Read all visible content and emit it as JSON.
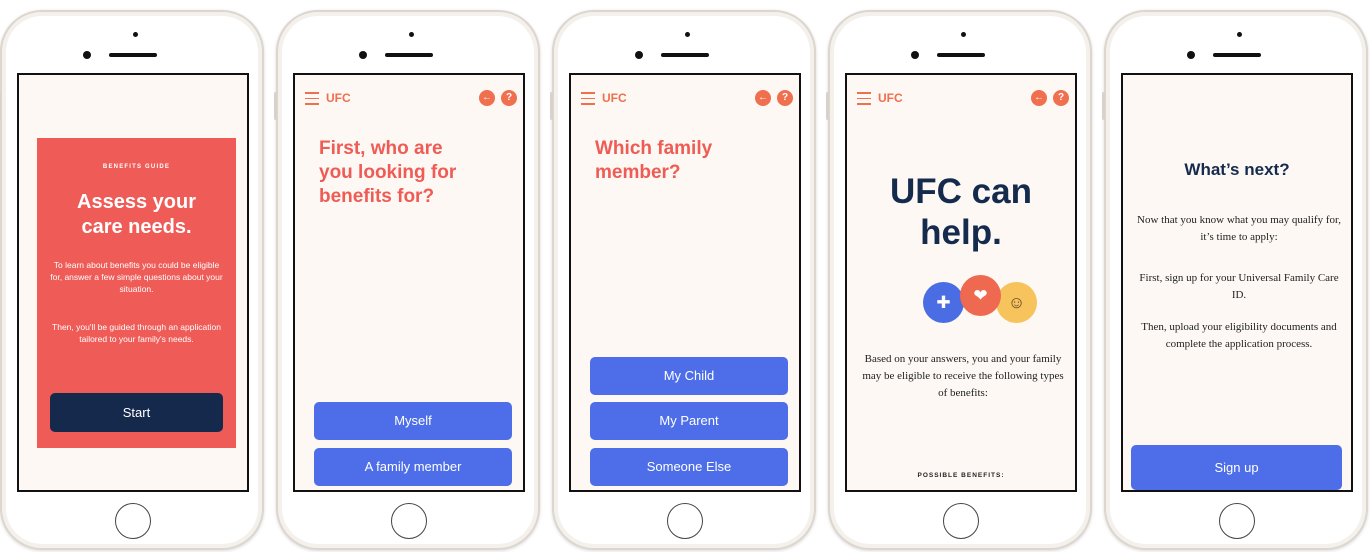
{
  "app": {
    "brand": "UFC",
    "back_glyph": "←",
    "help_glyph": "?"
  },
  "screen1": {
    "eyebrow": "BENEFITS GUIDE",
    "heading_line1": "Assess your",
    "heading_line2": "care needs.",
    "intro_text": "To learn about benefits you could be eligible for, answer a few simple questions about your situation.",
    "guided_text": "Then, you'll be guided through an application tailored to your family's needs.",
    "start_label": "Start"
  },
  "screen2": {
    "question_line1": "First, who are",
    "question_line2": "you looking for",
    "question_line3": "benefits for?",
    "options": [
      "Myself",
      "A family member"
    ]
  },
  "screen3": {
    "question_line1": "Which family",
    "question_line2": "member?",
    "options": [
      "My Child",
      "My Parent",
      "Someone Else"
    ]
  },
  "screen4": {
    "title_line1": "UFC can",
    "title_line2": "help.",
    "icons": [
      "shield-medical-icon",
      "handshake-heart-icon",
      "family-care-icon"
    ],
    "icon_glyphs": [
      "✚",
      "❤",
      "☺"
    ],
    "body_text": "Based on your answers, you and your family may be eligible to receive the following types of benefits:",
    "possible_label": "POSSIBLE BENEFITS:"
  },
  "screen5": {
    "title": "What’s next?",
    "para1": "Now that you know what you may qualify for, it’s time to apply:",
    "para2": "First, sign up for your Universal Family Care ID.",
    "para3": "Then, upload your eligibility documents and complete the application process.",
    "signup_label": "Sign up"
  },
  "colors": {
    "coral": "#ef5b57",
    "orange": "#ef6f4f",
    "navy": "#152b4e",
    "blue": "#4d6ee8",
    "cream": "#fdf8f3",
    "yellow": "#f6c35c"
  }
}
